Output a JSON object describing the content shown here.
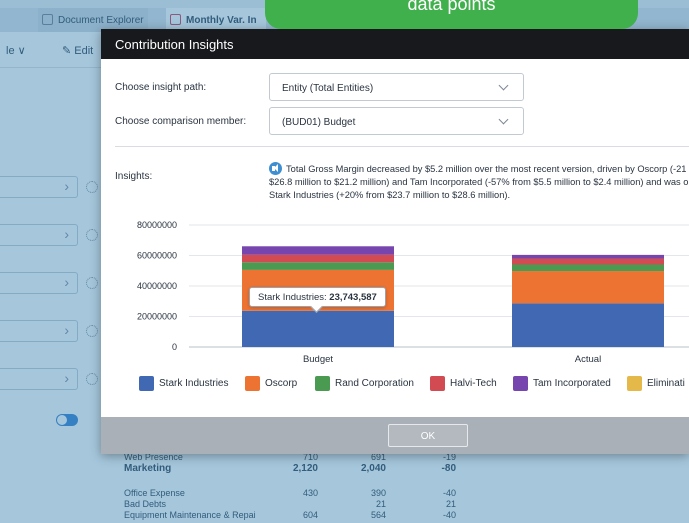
{
  "banner": {
    "text": "data points"
  },
  "background": {
    "tabs": [
      "Document Explorer",
      "Monthly Var. In"
    ],
    "toolbar": {
      "left_label": "le ∨",
      "edit_label": "Edit"
    },
    "table": [
      {
        "label": "Web Presence",
        "v1": "710",
        "v2": "691",
        "v3": "-19"
      },
      {
        "label": "Marketing",
        "v1": "2,120",
        "v2": "2,040",
        "v3": "-80"
      },
      {
        "label": "Office Expense",
        "v1": "430",
        "v2": "390",
        "v3": "-40"
      },
      {
        "label": "Bad Debts",
        "v1": "",
        "v2": "21",
        "v3": "21"
      },
      {
        "label": "Equipment Maintenance & Repai",
        "v1": "604",
        "v2": "564",
        "v3": "-40"
      }
    ]
  },
  "dialog": {
    "title": "Contribution Insights",
    "insight_path_label": "Choose insight path:",
    "insight_path_value": "Entity (Total Entities)",
    "comparison_label": "Choose comparison member:",
    "comparison_value": "(BUD01) Budget",
    "insights_label": "Insights:",
    "insight_line1": "Total Gross Margin decreased by $5.2 million over the most recent version, driven by Oscorp (-21",
    "insight_line2": "$26.8 million to $21.2 million) and Tam Incorporated (-57% from $5.5 million to $2.4 million) and was o",
    "insight_line3": "Stark Industries (+20% from $23.7 million to $28.6 million).",
    "tooltip_name": "Stark Industries:",
    "tooltip_value": "23,743,587",
    "ok_label": "OK"
  },
  "chart_data": {
    "type": "bar",
    "stacked": true,
    "categories": [
      "Budget",
      "Actual"
    ],
    "yticks": [
      "0",
      "20000000",
      "40000000",
      "60000000",
      "80000000"
    ],
    "ylim": [
      0,
      80000000
    ],
    "grid": true,
    "legend_position": "bottom",
    "series": [
      {
        "name": "Stark Industries",
        "color": "#4169b3",
        "values": [
          23743587,
          28600000
        ]
      },
      {
        "name": "Oscorp",
        "color": "#ed7332",
        "values": [
          26800000,
          21200000
        ]
      },
      {
        "name": "Rand Corporation",
        "color": "#4b9a52",
        "values": [
          5000000,
          4300000
        ]
      },
      {
        "name": "Halvi-Tech",
        "color": "#d24a52",
        "values": [
          5000000,
          3900000
        ]
      },
      {
        "name": "Tam Incorporated",
        "color": "#7645ad",
        "values": [
          5500000,
          2400000
        ]
      },
      {
        "name": "Eliminati",
        "color": "#e4b94a",
        "values": [
          0,
          0
        ]
      }
    ]
  }
}
